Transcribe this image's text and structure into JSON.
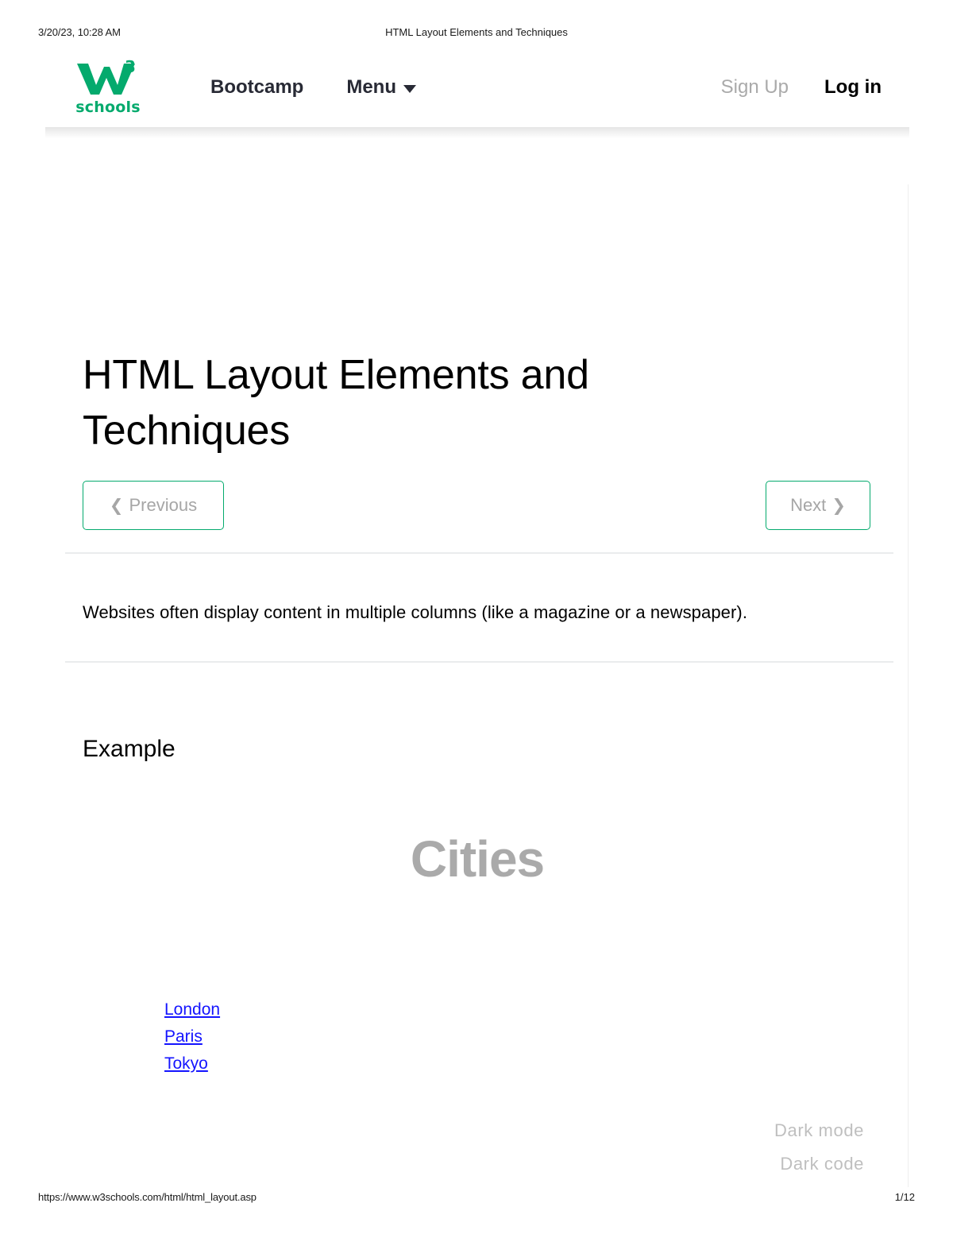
{
  "print": {
    "date": "3/20/23, 10:28 AM",
    "doc_title": "HTML Layout Elements and Techniques",
    "url": "https://www.w3schools.com/html/html_layout.asp",
    "page_number": "1/12"
  },
  "topbar": {
    "logo": {
      "mark_letter": "w",
      "mark_superscript": "3",
      "word": "schools",
      "color": "#04AA6D"
    },
    "nav_left": [
      {
        "label": "Bootcamp",
        "has_caret": false
      },
      {
        "label": "Menu",
        "has_caret": true
      }
    ],
    "nav_right": {
      "signup_label": "Sign Up",
      "login_label": "Log in"
    }
  },
  "main": {
    "title": "HTML Layout Elements and Techniques",
    "pager": {
      "previous_label": "Previous",
      "previous_chevron": "❮",
      "next_label": "Next",
      "next_chevron": "❯",
      "border_color": "#04AA6D",
      "text_color": "#a6a6a6"
    },
    "lead_paragraph": "Websites often display content in multiple columns (like a magazine or a newspaper).",
    "example_heading": "Example",
    "demo": {
      "heading": "Cities",
      "heading_color": "#aaaaaa",
      "links": [
        {
          "label": "London"
        },
        {
          "label": "Paris"
        },
        {
          "label": "Tokyo"
        }
      ],
      "link_color": "#1414ff"
    }
  },
  "dark_mode_widget": {
    "lines": [
      "Dark mode",
      "Dark code"
    ]
  }
}
